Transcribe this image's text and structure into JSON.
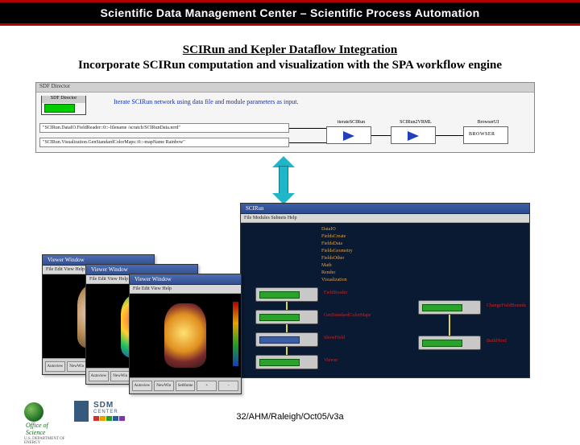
{
  "header": {
    "title": "Scientific Data Management Center – Scientific Process Automation"
  },
  "title_block": {
    "line1": "SCIRun and Kepler Dataflow Integration",
    "line2": "Incorporate SCIRun computation and visualization with the SPA workflow engine"
  },
  "kepler": {
    "window_title": "SDF Director",
    "director_label": "SDF Director",
    "info": "Iterate SCIRun network using data file and module parameters as input.",
    "param1": "\"SCIRun.DataIO.FieldReader::0::-filename /scratch/SCIRunData.nrrd\"",
    "param2": "\"SCIRun.Visualization.GenStandardColorMaps::0::-mapName Rainbow\"",
    "actor1": "iterateSCIRun",
    "actor2": "SCIRun2VRML",
    "actor3_top": "BrowserUI",
    "actor3_body": "BROWSER"
  },
  "scirun": {
    "title": "SCIRun",
    "menu": "File  Modules  Subnets  Help",
    "categories": [
      "DataIO",
      "FieldsCreate",
      "FieldsData",
      "FieldsGeometry",
      "FieldsOther",
      "Math",
      "Render",
      "Visualization"
    ],
    "modules": [
      {
        "label": "FieldReader"
      },
      {
        "label": "GenStandardColorMaps"
      },
      {
        "label": "ShowField"
      },
      {
        "label": "Viewer"
      },
      {
        "label": "ChangeFieldBounds"
      },
      {
        "label": "BuildNrrd"
      }
    ]
  },
  "viewers": {
    "title": "Viewer Window",
    "menu": "File  Edit  View  Help",
    "buttons": [
      "Autoview",
      "NewWin",
      "SetHome",
      "+",
      "-"
    ]
  },
  "footer": {
    "slide_number": "32/AHM/Raleigh/Oct05/v3a",
    "office_line1": "Office of",
    "office_line2": "Science",
    "office_sub": "U.S. DEPARTMENT OF ENERGY",
    "sdm": "SDM",
    "sdm_center": "CENTER"
  }
}
